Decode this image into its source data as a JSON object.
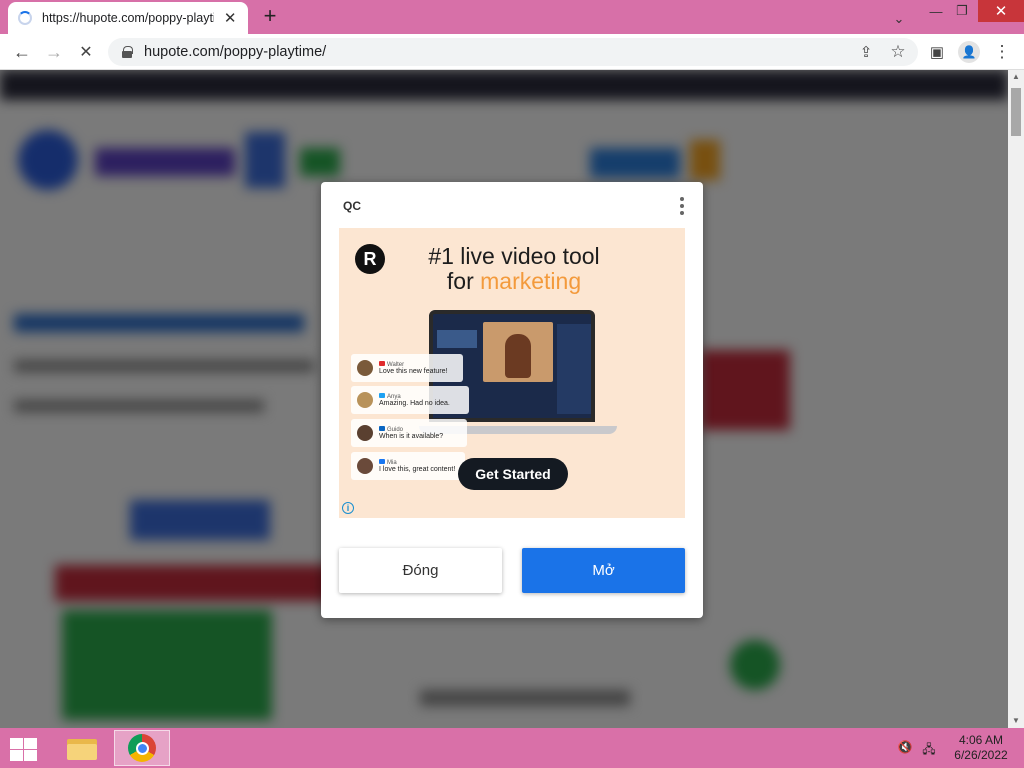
{
  "browser": {
    "tab_title": "https://hupote.com/poppy-playtime/",
    "tab_close": "✕",
    "new_tab": "+",
    "url": "hupote.com/poppy-playtime/",
    "window_controls": {
      "chevron": "⌄",
      "minimize": "—",
      "restore": "❐",
      "close": "✕"
    },
    "nav": {
      "back": "←",
      "forward": "→",
      "stop": "✕"
    },
    "toolbar_icons": {
      "share": "⇪",
      "star": "☆",
      "sidepanel": "▣",
      "profile": "👤",
      "menu": "⋮"
    }
  },
  "modal": {
    "ad_label": "QC",
    "ad": {
      "logo_letter": "R",
      "headline_line1": "#1 live video tool",
      "headline_for": "for ",
      "headline_accent": "marketing",
      "cta": "Get Started",
      "info_icon": "i",
      "comments": [
        {
          "name": "Walter",
          "message": "Love this new feature!",
          "platform_color": "#e02a2a"
        },
        {
          "name": "Anya",
          "message": "Amazing. Had no idea.",
          "platform_color": "#1da1f2"
        },
        {
          "name": "Guido",
          "message": "When is it available?",
          "platform_color": "#0a66c2"
        },
        {
          "name": "Mia",
          "message": "I love this, great content!",
          "platform_color": "#1877f2"
        }
      ]
    },
    "close_button": "Đóng",
    "open_button": "Mở"
  },
  "taskbar": {
    "time": "4:06 AM",
    "date": "6/26/2022",
    "volume_icon": "🔇",
    "network_icon": "🖧"
  },
  "colors": {
    "titlebar": "#d770a8",
    "taskbar": "#d970a8",
    "accent_blue": "#1a73e8",
    "ad_accent": "#f39a3c",
    "ad_bg": "#fce6d2"
  }
}
